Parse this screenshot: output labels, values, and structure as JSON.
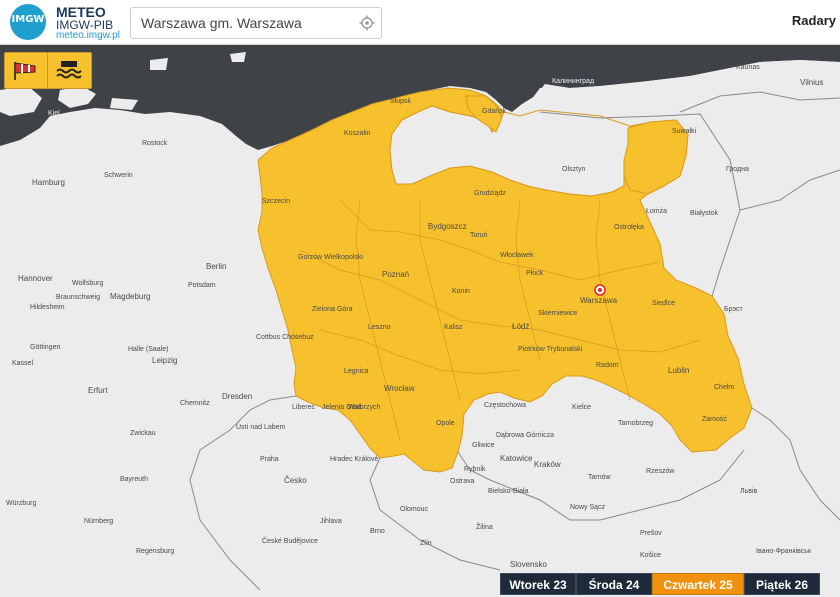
{
  "header": {
    "logo_badge": "IMGW",
    "logo_line1": "METEO",
    "logo_line2": "IMGW-PIB",
    "logo_line3": "meteo.imgw.pl",
    "search_value": "Warszawa gm. Warszawa",
    "radars_label": "Radary"
  },
  "warnings": {
    "wind_icon": "windsock-icon",
    "flood_icon": "flood-waves-icon",
    "level_color": "#f6c12c"
  },
  "map": {
    "selected_location": "Warszawa",
    "labels": {
      "kaliningrad": "Калининград",
      "gdansk": "Gdańsk",
      "slupsk": "Słupsk",
      "koszalin": "Koszalin",
      "szczecin": "Szczecin",
      "olsztyn": "Olsztyn",
      "suwalki": "Suwałki",
      "lomza": "Łomża",
      "bialystok": "Białystok",
      "ostroleka": "Ostrołęka",
      "grudziadz": "Grudziądz",
      "bydgoszcz": "Bydgoszcz",
      "torun": "Toruń",
      "wloclawek": "Włocławek",
      "plock": "Płock",
      "gorzow": "Gorzów Wielkopolski",
      "poznan": "Poznań",
      "konin": "Konin",
      "zielona": "Zielona Góra",
      "leszno": "Leszno",
      "kalisz": "Kalisz",
      "lodz": "Łódź",
      "skierniewice": "Skierniewice",
      "warszawa": "Warszawa",
      "siedlce": "Siedlce",
      "brest": "Брэст",
      "piotrkow": "Piotrków Trybunalski",
      "radom": "Radom",
      "lublin": "Lublin",
      "chelm": "Chełm",
      "zamosc": "Zamość",
      "legnica": "Legnica",
      "wroclaw": "Wrocław",
      "walbrzych": "Wałbrzych",
      "jelenia": "Jelenia Góra",
      "opole": "Opole",
      "czestochowa": "Częstochowa",
      "kielce": "Kielce",
      "tarnobrzeg": "Tarnobrzeg",
      "gliwice": "Gliwice",
      "katowice": "Katowice",
      "dabrowa": "Dąbrowa Górnicza",
      "krakow": "Kraków",
      "rybnik": "Rybnik",
      "bielsko": "Bielsko-Biała",
      "tarnow": "Tarnów",
      "rzeszow": "Rzeszów",
      "nowysacz": "Nowy Sącz",
      "zilina": "Žilina",
      "slovensko": "Slovensko",
      "ostrava": "Ostrava",
      "olomouc": "Olomouc",
      "brno": "Brno",
      "cesko": "Česko",
      "praha": "Praha",
      "hradec": "Hradec Králové",
      "liberec": "Liberec",
      "usti": "Ústí nad Labem",
      "ceske": "České Budějovice",
      "dresden": "Dresden",
      "chemnitz": "Chemnitz",
      "cottbus": "Cottbus Chóśebuz",
      "leipzig": "Leipzig",
      "halle": "Halle (Saale)",
      "erfurt": "Erfurt",
      "gottingen": "Göttingen",
      "kassel": "Kassel",
      "magdeburg": "Magdeburg",
      "berlin": "Berlin",
      "potsdam": "Potsdam",
      "hannover": "Hannover",
      "wolfsburg": "Wolfsburg",
      "braunschweig": "Braunschweig",
      "hildesheim": "Hildesheim",
      "hamburg": "Hamburg",
      "schwerin": "Schwerin",
      "rostock": "Rostock",
      "kiel": "Kiel",
      "lviv": "Львів",
      "ivano": "Івано-Франківськ",
      "grodno": "Гродна",
      "vilnius": "Vilnius",
      "kaunas": "Kaunas",
      "chemnitz2": "Zwickau",
      "nurnberg": "Nürnberg",
      "regensburg": "Regensburg",
      "wurzburg": "Würzburg",
      "bayreuth": "Bayreuth",
      "jihlava": "Jihlava",
      "zlin": "Zlín",
      "kosice": "Košice",
      "presov": "Prešov"
    }
  },
  "days": [
    {
      "label": "Wtorek 23",
      "active": false
    },
    {
      "label": "Środa 24",
      "active": false
    },
    {
      "label": "Czwartek 25",
      "active": true
    },
    {
      "label": "Piątek 26",
      "active": false
    }
  ]
}
